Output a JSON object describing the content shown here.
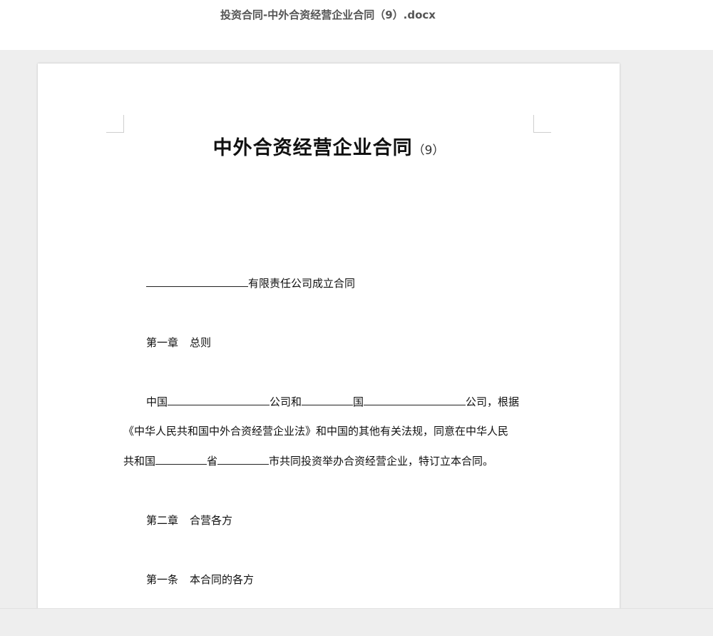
{
  "window": {
    "file_name": "投资合同-中外合资经营企业合同（9）.docx"
  },
  "document": {
    "title_main": "中外合资经营企业合同",
    "title_suffix": "（9）",
    "line1_text": "有限责任公司成立合同",
    "chapter1_label": "第一章",
    "chapter1_title": "总则",
    "para1_country": "中国",
    "para1_company_and": "公司和",
    "para1_country2": "国",
    "para1_company_basis": "公司，根据",
    "para1_line2": "《中华人民共和国中外合资经营企业法》和中国的其他有关法规，同意在中华人民",
    "para1_line3_start": "共和国",
    "para1_line3_province": "省",
    "para1_line3_end": "市共同投资举办合资经营企业，特订立本合同。",
    "chapter2_label": "第二章",
    "chapter2_title": "合营各方",
    "article1_label": "第一条",
    "article1_title": "本合同的各方"
  }
}
